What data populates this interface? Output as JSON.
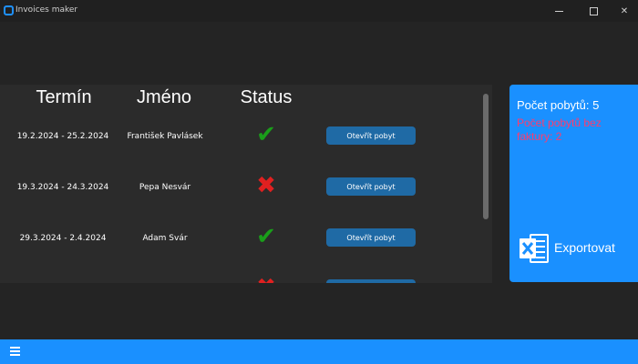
{
  "window": {
    "title": "Invoices maker",
    "app_icon": "app-icon",
    "controls": [
      "minimize-icon",
      "maximize-icon",
      "close-icon"
    ]
  },
  "table": {
    "headers": {
      "termin": "Termín",
      "jmeno": "Jméno",
      "status": "Status"
    },
    "rows": [
      {
        "date": "19.2.2024 - 25.2.2024",
        "name": "František Pavlásek",
        "status": "ok",
        "status_icon": "checkmark-icon",
        "button": "Otevřít pobyt"
      },
      {
        "date": "19.3.2024 - 24.3.2024",
        "name": "Pepa Nesvár",
        "status": "missing",
        "status_icon": "cross-icon",
        "button": "Otevřít pobyt"
      },
      {
        "date": "29.3.2024 - 2.4.2024",
        "name": "Adam Svár",
        "status": "ok",
        "status_icon": "checkmark-icon",
        "button": "Otevřít pobyt"
      },
      {
        "date": "",
        "name": "",
        "status": "missing",
        "status_icon": "cross-icon",
        "button": ""
      }
    ]
  },
  "stats": {
    "count_text": "Počet pobytů: 5",
    "no_invoice_text": "Počet pobytů bez faktury: 2",
    "export_label": "Exportovat",
    "export_icon": "excel-icon"
  },
  "bottom_bar": {
    "menu_icon": "hamburger-menu-icon"
  },
  "colors": {
    "accent": "#1a90ff",
    "button": "#1f6aa5",
    "ok": "#1a9e1a",
    "missing": "#e02020",
    "warning_text": "#ff3b6e",
    "background": "#242424",
    "panel": "#2b2b2b"
  }
}
